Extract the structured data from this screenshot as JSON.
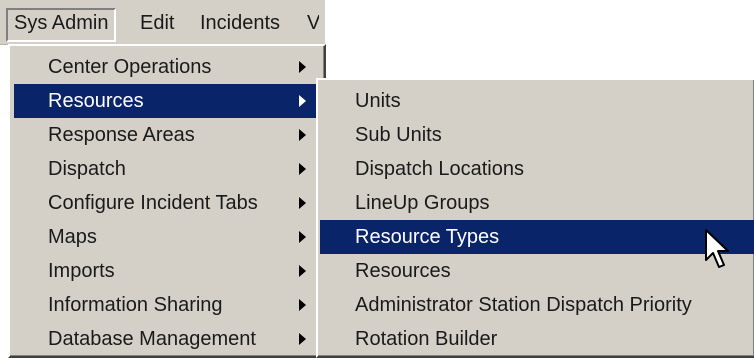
{
  "menubar": {
    "items": [
      "Sys Admin",
      "Edit",
      "Incidents",
      "V"
    ]
  },
  "main_menu": {
    "items": [
      {
        "label": "Center Operations",
        "submenu": true,
        "highlighted": false
      },
      {
        "label": "Resources",
        "submenu": true,
        "highlighted": true
      },
      {
        "label": "Response Areas",
        "submenu": true,
        "highlighted": false
      },
      {
        "label": "Dispatch",
        "submenu": true,
        "highlighted": false
      },
      {
        "label": "Configure Incident Tabs",
        "submenu": true,
        "highlighted": false
      },
      {
        "label": "Maps",
        "submenu": true,
        "highlighted": false
      },
      {
        "label": "Imports",
        "submenu": true,
        "highlighted": false
      },
      {
        "label": "Information Sharing",
        "submenu": true,
        "highlighted": false
      },
      {
        "label": "Database Management",
        "submenu": true,
        "highlighted": false
      }
    ]
  },
  "resources_submenu": {
    "items": [
      {
        "label": "Units",
        "highlighted": false
      },
      {
        "label": "Sub Units",
        "highlighted": false
      },
      {
        "label": "Dispatch Locations",
        "highlighted": false
      },
      {
        "label": "LineUp Groups",
        "highlighted": false
      },
      {
        "label": "Resource Types",
        "highlighted": true
      },
      {
        "label": "Resources",
        "highlighted": false
      },
      {
        "label": "Administrator Station Dispatch Priority",
        "highlighted": false
      },
      {
        "label": "Rotation Builder",
        "highlighted": false
      }
    ]
  },
  "colors": {
    "menu_bg": "#d4d0c8",
    "highlight_bg": "#0a246a",
    "highlight_text": "#ffffff",
    "text": "#1a1a1a"
  },
  "icons": {
    "submenu_arrow": "submenu-arrow-icon",
    "pointer": "mouse-pointer-icon"
  }
}
